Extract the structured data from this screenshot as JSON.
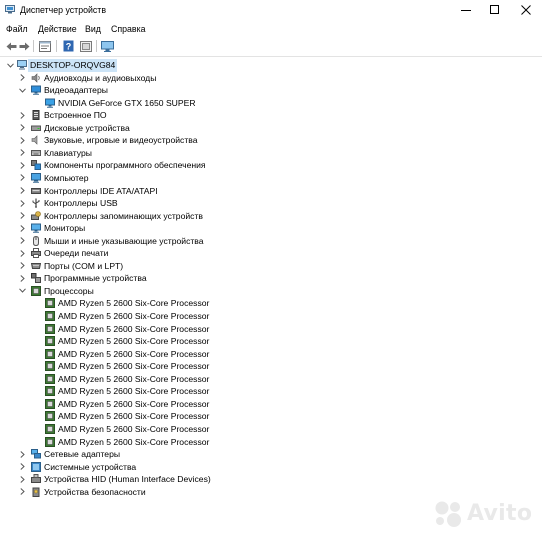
{
  "window": {
    "title": "Диспетчер устройств"
  },
  "menu": [
    "Файл",
    "Действие",
    "Вид",
    "Справка"
  ],
  "toolbar_icons": [
    "back-arrow-icon",
    "forward-arrow-icon",
    "properties-icon",
    "help-icon",
    "update-driver-icon",
    "monitor-icon"
  ],
  "tree": {
    "root": "DESKTOP-ORQVG84",
    "nodes": [
      {
        "label": "Аудиовходы и аудиовыходы",
        "icon": "audio-io-icon",
        "expanded": false
      },
      {
        "label": "Видеоадаптеры",
        "icon": "display-adapter-icon",
        "expanded": true,
        "children": [
          "NVIDIA GeForce GTX 1650 SUPER"
        ]
      },
      {
        "label": "Встроенное ПО",
        "icon": "firmware-icon",
        "expanded": false
      },
      {
        "label": "Дисковые устройства",
        "icon": "disk-icon",
        "expanded": false
      },
      {
        "label": "Звуковые, игровые и видеоустройства",
        "icon": "sound-icon",
        "expanded": false
      },
      {
        "label": "Клавиатуры",
        "icon": "keyboard-icon",
        "expanded": false
      },
      {
        "label": "Компоненты программного обеспечения",
        "icon": "software-component-icon",
        "expanded": false
      },
      {
        "label": "Компьютер",
        "icon": "computer-icon",
        "expanded": false
      },
      {
        "label": "Контроллеры IDE ATA/ATAPI",
        "icon": "ide-controller-icon",
        "expanded": false
      },
      {
        "label": "Контроллеры USB",
        "icon": "usb-icon",
        "expanded": false
      },
      {
        "label": "Контроллеры запоминающих устройств",
        "icon": "storage-controller-icon",
        "expanded": false
      },
      {
        "label": "Мониторы",
        "icon": "monitor-icon",
        "expanded": false
      },
      {
        "label": "Мыши и иные указывающие устройства",
        "icon": "mouse-icon",
        "expanded": false
      },
      {
        "label": "Очереди печати",
        "icon": "printer-icon",
        "expanded": false
      },
      {
        "label": "Порты (COM и LPT)",
        "icon": "port-icon",
        "expanded": false
      },
      {
        "label": "Программные устройства",
        "icon": "software-device-icon",
        "expanded": false
      },
      {
        "label": "Процессоры",
        "icon": "cpu-icon",
        "expanded": true,
        "children": [
          "AMD Ryzen 5 2600 Six-Core Processor",
          "AMD Ryzen 5 2600 Six-Core Processor",
          "AMD Ryzen 5 2600 Six-Core Processor",
          "AMD Ryzen 5 2600 Six-Core Processor",
          "AMD Ryzen 5 2600 Six-Core Processor",
          "AMD Ryzen 5 2600 Six-Core Processor",
          "AMD Ryzen 5 2600 Six-Core Processor",
          "AMD Ryzen 5 2600 Six-Core Processor",
          "AMD Ryzen 5 2600 Six-Core Processor",
          "AMD Ryzen 5 2600 Six-Core Processor",
          "AMD Ryzen 5 2600 Six-Core Processor",
          "AMD Ryzen 5 2600 Six-Core Processor"
        ]
      },
      {
        "label": "Сетевые адаптеры",
        "icon": "network-icon",
        "expanded": false
      },
      {
        "label": "Системные устройства",
        "icon": "system-device-icon",
        "expanded": false
      },
      {
        "label": "Устройства HID (Human Interface Devices)",
        "icon": "hid-icon",
        "expanded": false
      },
      {
        "label": "Устройства безопасности",
        "icon": "security-icon",
        "expanded": false
      }
    ]
  },
  "watermark": {
    "text": "Avito"
  }
}
